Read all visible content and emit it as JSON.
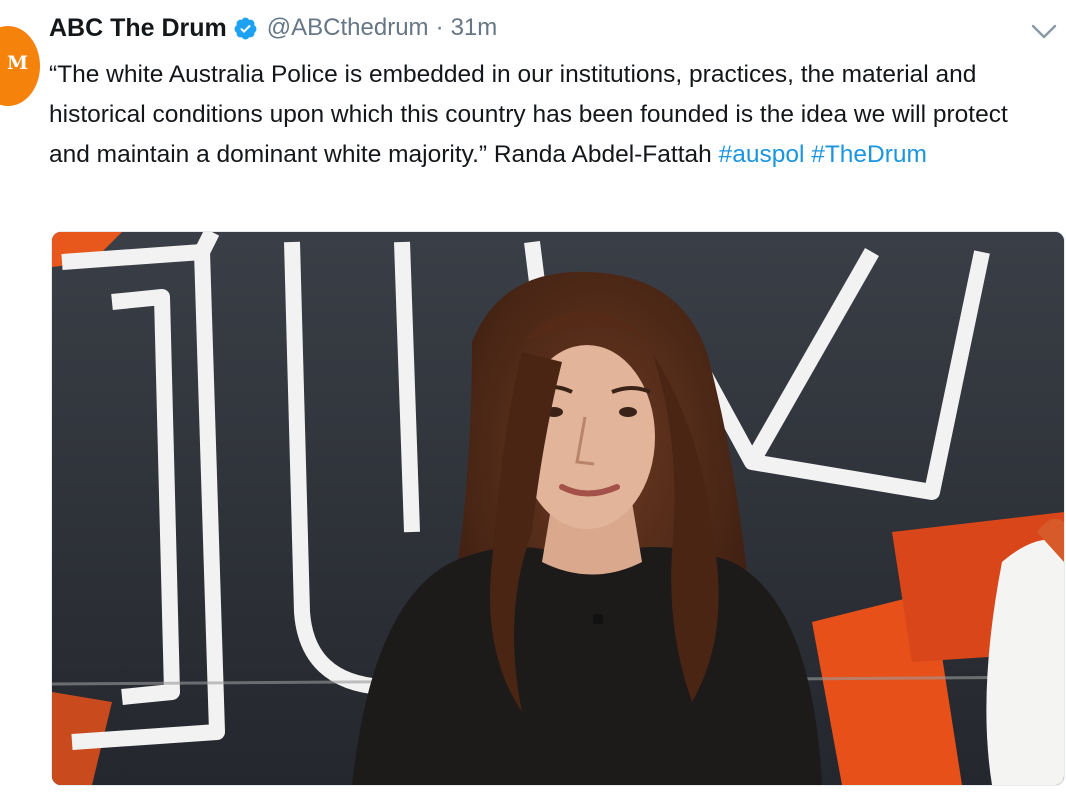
{
  "tweet": {
    "avatar_text": "M",
    "display_name": "ABC The Drum",
    "handle": "@ABCthedrum",
    "separator": "·",
    "timestamp": "31m",
    "text_body": "“The white Australia Police is embedded in our institutions, practices, the material and historical conditions upon which this country has been founded is the idea we will protect and maintain a dominant white majority.” Randa Abdel-Fattah ",
    "hashtags": [
      "#auspol",
      "#TheDrum"
    ]
  },
  "icons": {
    "verified": "verified-badge-icon",
    "more": "chevron-down-icon"
  },
  "colors": {
    "avatar_bg": "#f5820a",
    "verified_blue": "#1da1f2",
    "hashtag_blue": "#1b95e0",
    "text": "#14171a",
    "muted": "#657786"
  }
}
